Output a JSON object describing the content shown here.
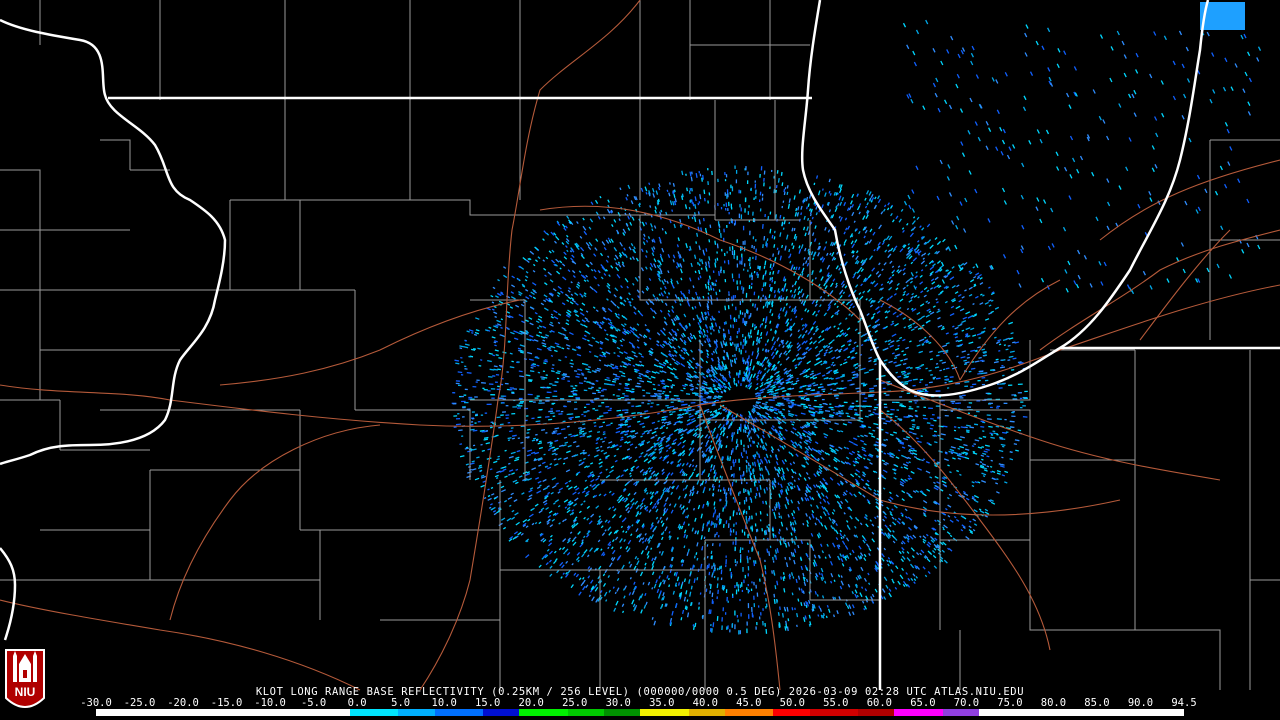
{
  "caption": "KLOT LONG RANGE BASE REFLECTIVITY (0.25KM / 256 LEVEL) (000000/0000 0.5 DEG) 2026-03-09 02:28 UTC  ATLAS.NIU.EDU",
  "logo": {
    "name": "niu-logo",
    "text": "NIU"
  },
  "scale": {
    "labels": [
      "-30.0",
      "-25.0",
      "-20.0",
      "-15.0",
      "-10.0",
      "-5.0",
      "0.0",
      "5.0",
      "10.0",
      "15.0",
      "20.0",
      "25.0",
      "30.0",
      "35.0",
      "40.0",
      "45.0",
      "50.0",
      "55.0",
      "60.0",
      "65.0",
      "70.0",
      "75.0",
      "80.0",
      "85.0",
      "90.0",
      "94.5"
    ],
    "colors": [
      "#ffffff",
      "#ffffff",
      "#ffffff",
      "#ffffff",
      "#ffffff",
      "#ffffff",
      "#00e5ff",
      "#00b0ff",
      "#0070ff",
      "#0010d0",
      "#00f000",
      "#00c800",
      "#009000",
      "#f0f000",
      "#e0b000",
      "#ff8000",
      "#ff0000",
      "#d00000",
      "#b00000",
      "#ff00ff",
      "#9040e0",
      "#ffffff",
      "#ffffff",
      "#ffffff",
      "#ffffff",
      "#ffffff"
    ]
  },
  "map": {
    "radar_site": "KLOT",
    "echo_colors": [
      "#00d8ff",
      "#00a8e8",
      "#2f8dff",
      "#1060ff"
    ]
  }
}
